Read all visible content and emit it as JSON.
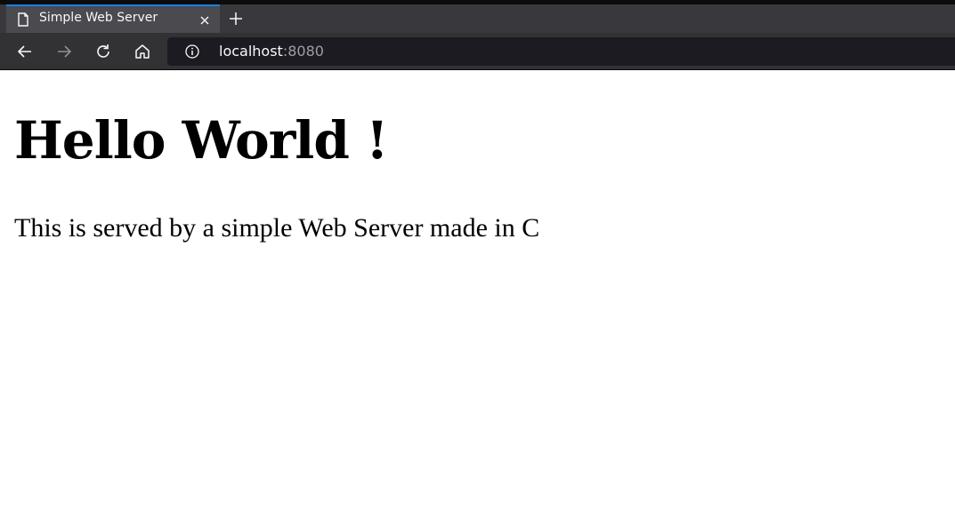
{
  "browser": {
    "tab": {
      "title": "Simple Web Server",
      "icon": "page-icon"
    },
    "toolbar": {
      "back_icon": "back-arrow-icon",
      "forward_icon": "forward-arrow-icon",
      "reload_icon": "reload-icon",
      "home_icon": "home-icon"
    },
    "url": {
      "host": "localhost",
      "port": ":8080"
    }
  },
  "page": {
    "heading": "Hello World !",
    "paragraph": "This is served by a simple Web Server made in C"
  },
  "colors": {
    "tab_bar": "#38383d",
    "active_tab": "#4a4a4f",
    "nav_bar": "#323234",
    "url_bar": "#1c1b22",
    "accent": "#0a84ff"
  }
}
